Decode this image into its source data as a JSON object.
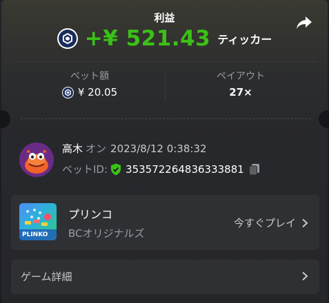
{
  "header": {
    "title": "利益",
    "profit_amount": "+¥ 521.43",
    "ticker_label": "ティッカー",
    "accent_color": "#3bc117"
  },
  "bet_info": {
    "bet_amount_label": "ベット額",
    "bet_amount_value": "¥ 20.05",
    "payout_label": "ペイアウト",
    "payout_value": "27×"
  },
  "user": {
    "name": "高木",
    "on_label": "オン",
    "timestamp": "2023/8/12 0:38:32",
    "bet_id_label": "ベットID:",
    "bet_id_value": "353572264836333881"
  },
  "game": {
    "name": "プリンコ",
    "provider": "BCオリジナルズ",
    "play_now_label": "今すぐプレイ",
    "thumb_label": "PLINKO"
  },
  "details": {
    "label": "ゲーム詳細"
  },
  "icons": {
    "currency": "coin-icon",
    "share": "share-icon",
    "verified": "shield-check-icon",
    "copy": "copy-icon",
    "chevron": "chevron-right-icon"
  }
}
